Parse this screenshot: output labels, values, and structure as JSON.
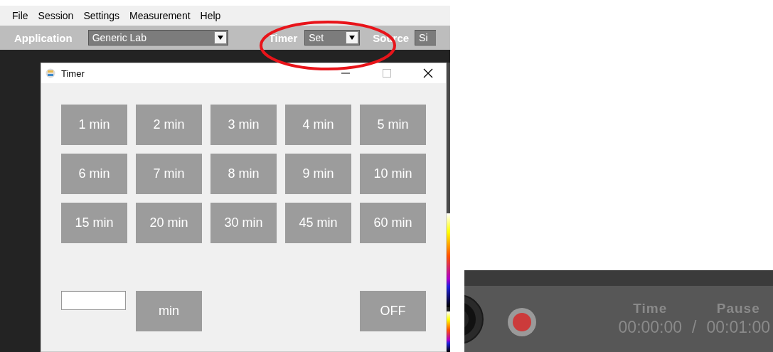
{
  "menu": [
    "File",
    "Session",
    "Settings",
    "Measurement",
    "Help"
  ],
  "toolbar": {
    "application_label": "Application",
    "application_value": "Generic Lab",
    "timer_label": "Timer",
    "timer_value": "Set",
    "source_label": "Source",
    "source_value": "Si"
  },
  "dialog": {
    "title": "Timer",
    "presets": [
      "1 min",
      "2 min",
      "3 min",
      "4 min",
      "5 min",
      "6 min",
      "7 min",
      "8 min",
      "9 min",
      "10 min",
      "15 min",
      "20 min",
      "30 min",
      "45 min",
      "60 min"
    ],
    "unit_button": "min",
    "off_button": "OFF"
  },
  "recorder": {
    "time_label": "Time",
    "pause_label": "Pause",
    "elapsed": "00:00:00",
    "separator": "/",
    "pause_time": "00:01:00"
  }
}
